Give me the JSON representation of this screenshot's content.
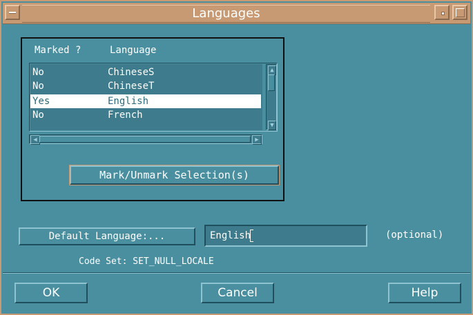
{
  "window": {
    "title": "Languages"
  },
  "language_list": {
    "column_marked": "Marked ?",
    "column_language": "Language",
    "rows": [
      {
        "marked": "No",
        "language": "ChineseS",
        "selected": false
      },
      {
        "marked": "No",
        "language": "ChineseT",
        "selected": false
      },
      {
        "marked": "Yes",
        "language": "English",
        "selected": true
      },
      {
        "marked": "No",
        "language": "French",
        "selected": false
      }
    ],
    "mark_button_label": "Mark/Unmark Selection(s)"
  },
  "default_language": {
    "button_label": "Default Language:...",
    "value": "English",
    "optional_label": "(optional)",
    "code_set_label": "Code Set: SET_NULL_LOCALE"
  },
  "actions": {
    "ok_label": "OK",
    "cancel_label": "Cancel",
    "help_label": "Help"
  },
  "colors": {
    "background": "#4a8fa0",
    "titlebar": "#c79a73",
    "selection": "#ffffff"
  }
}
